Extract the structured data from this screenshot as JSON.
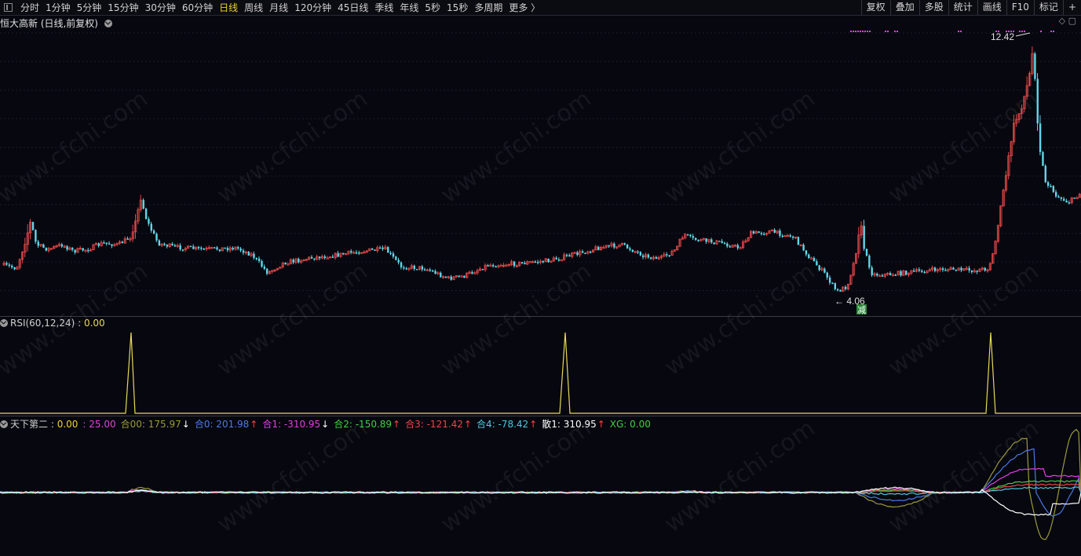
{
  "toolbar": {
    "periods": [
      "分时",
      "1分钟",
      "5分钟",
      "15分钟",
      "30分钟",
      "60分钟",
      "日线",
      "周线",
      "月线",
      "120分钟",
      "45日线",
      "季线",
      "年线",
      "5秒",
      "15秒",
      "多周期",
      "更多 〉"
    ],
    "active_period": "日线",
    "right_buttons": [
      "复权",
      "叠加",
      "多股",
      "统计",
      "画线",
      "F10",
      "标记",
      "+"
    ]
  },
  "main_chart": {
    "title": "恒大高新 (日线,前复权)",
    "high_label": "12.42",
    "low_label": "4.06",
    "low_badge": "减",
    "up_color": "#e04848",
    "down_color": "#60d8e8",
    "top_icons": "◇ ▢"
  },
  "rsi": {
    "name": "RSI(60,12,24)",
    "value": "0.00",
    "line_color": "#e8d85a"
  },
  "indicator": {
    "name": "天下第二",
    "items": [
      {
        "label": "",
        "value": "0.00",
        "color": "#f0d030",
        "arrow": ""
      },
      {
        "label": "",
        "value": "25.00",
        "color": "#e040e0",
        "arrow": ""
      },
      {
        "label": "合00:",
        "value": "175.97",
        "color": "#9a9a3a",
        "arrow": "↓",
        "arrow_color": "#ffffff"
      },
      {
        "label": "合0:",
        "value": "201.98",
        "color": "#4a7ae8",
        "arrow": "↑",
        "arrow_color": "#ff4040"
      },
      {
        "label": "合1:",
        "value": "-310.95",
        "color": "#e040e0",
        "arrow": "↓",
        "arrow_color": "#ffffff"
      },
      {
        "label": "合2:",
        "value": "-150.89",
        "color": "#40d040",
        "arrow": "↑",
        "arrow_color": "#ff4040"
      },
      {
        "label": "合3:",
        "value": "-121.42",
        "color": "#e84848",
        "arrow": "↑",
        "arrow_color": "#ff4040"
      },
      {
        "label": "合4:",
        "value": "-78.42",
        "color": "#50c8e0",
        "arrow": "↑",
        "arrow_color": "#ff4040"
      },
      {
        "label": "散1:",
        "value": "310.95",
        "color": "#ffffff",
        "arrow": "↑",
        "arrow_color": "#ff4040"
      },
      {
        "label": "XG:",
        "value": "0.00",
        "color": "#40d040",
        "arrow": ""
      }
    ]
  },
  "watermark": "www.cfchi.com"
}
